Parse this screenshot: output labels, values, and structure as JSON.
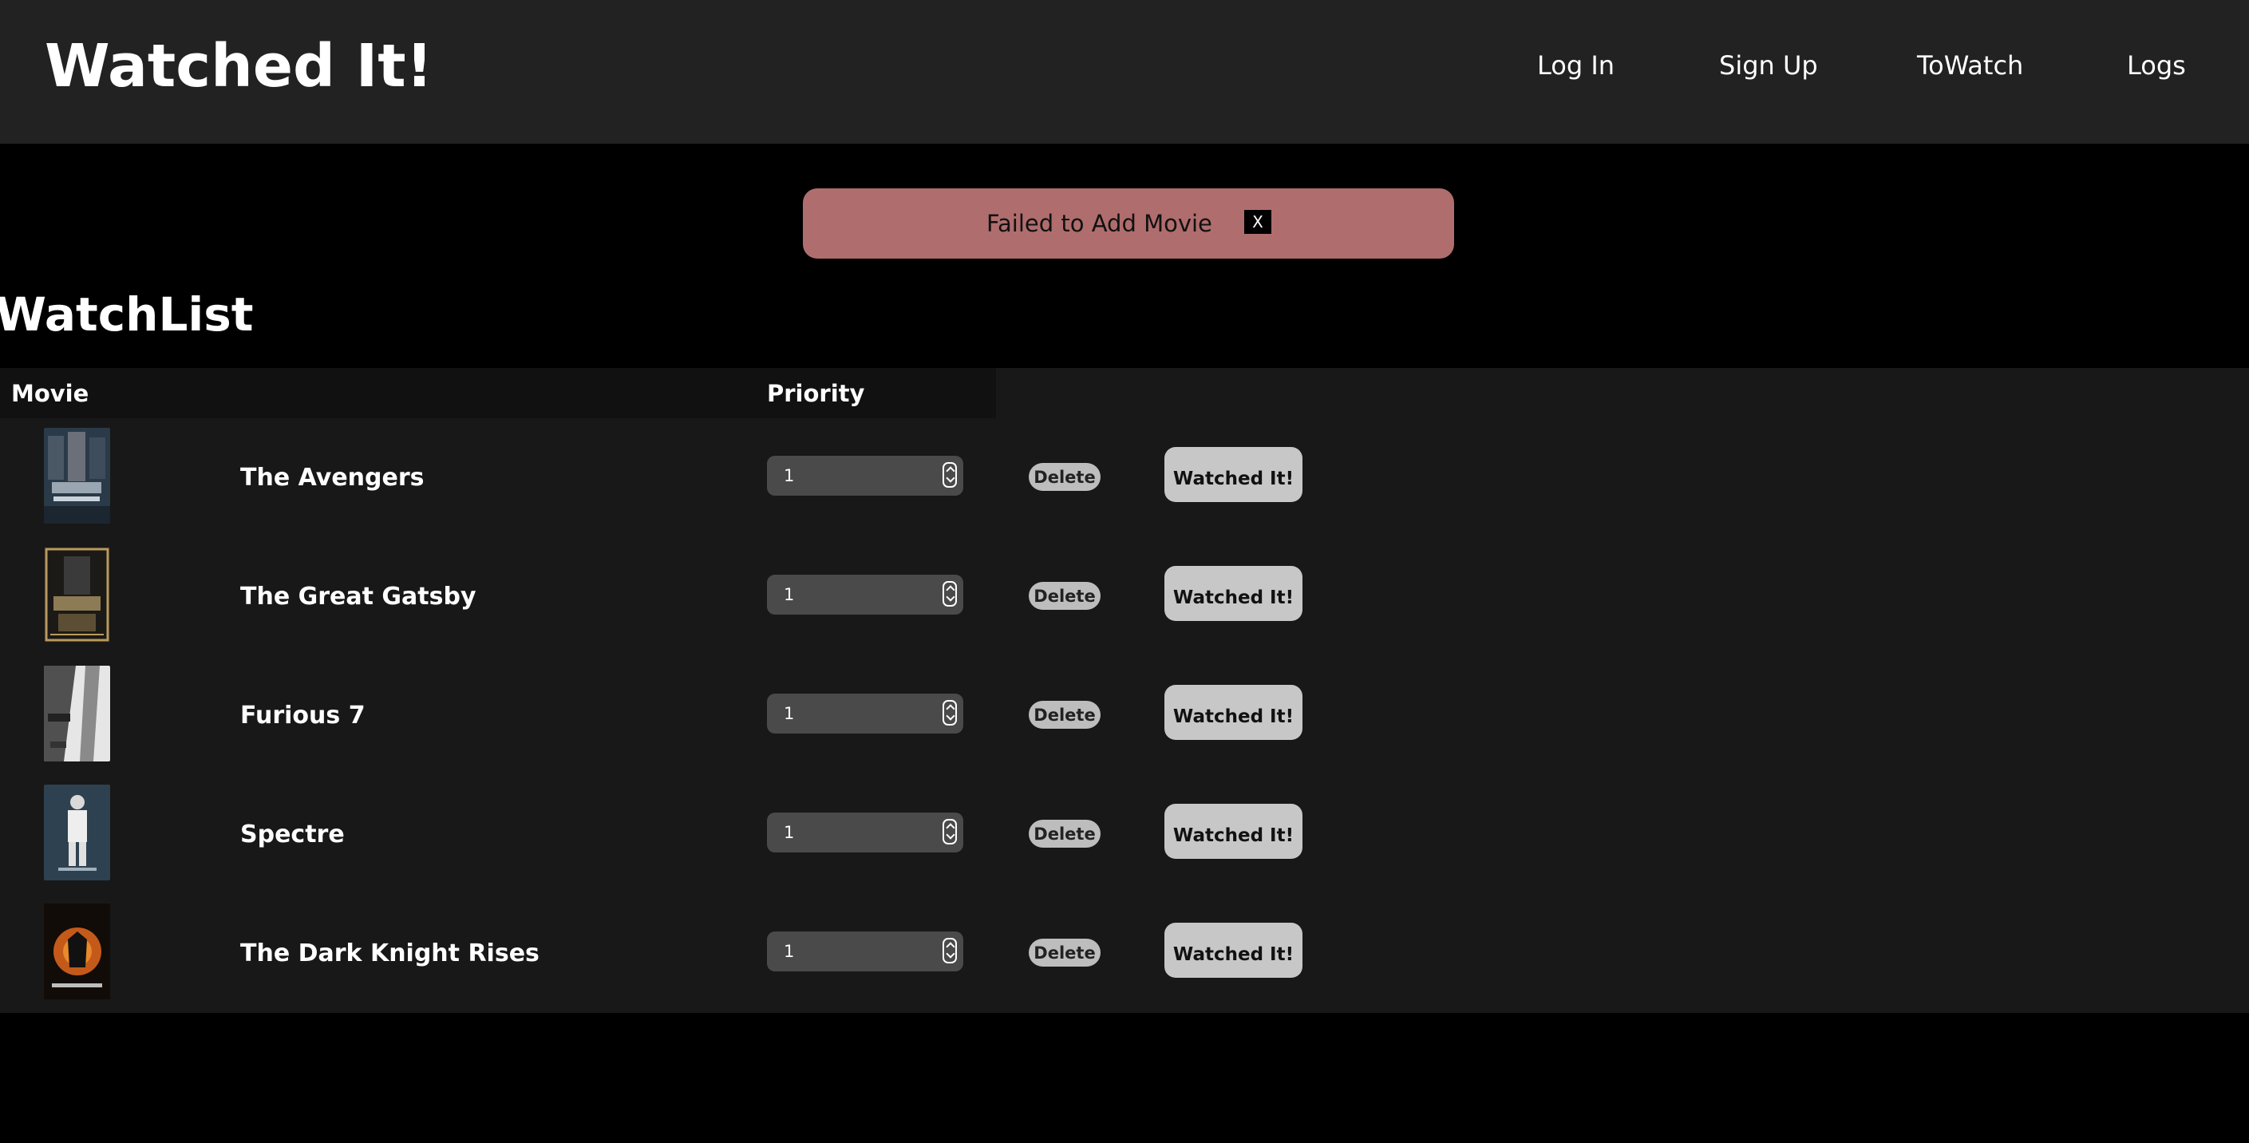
{
  "header": {
    "title": "Watched It!",
    "nav": [
      {
        "label": "Log In"
      },
      {
        "label": "Sign Up"
      },
      {
        "label": "ToWatch"
      },
      {
        "label": "Logs"
      }
    ]
  },
  "alert": {
    "message": "Failed to Add Movie",
    "close_label": "X"
  },
  "page_heading": "WatchList",
  "table": {
    "headers": {
      "movie": "Movie",
      "priority": "Priority"
    },
    "rows": [
      {
        "title": "The Avengers",
        "priority": "1",
        "delete_label": "Delete",
        "watched_label": "Watched It!"
      },
      {
        "title": "The Great Gatsby",
        "priority": "1",
        "delete_label": "Delete",
        "watched_label": "Watched It!"
      },
      {
        "title": "Furious 7",
        "priority": "1",
        "delete_label": "Delete",
        "watched_label": "Watched It!"
      },
      {
        "title": "Spectre",
        "priority": "1",
        "delete_label": "Delete",
        "watched_label": "Watched It!"
      },
      {
        "title": "The Dark Knight Rises",
        "priority": "1",
        "delete_label": "Delete",
        "watched_label": "Watched It!"
      }
    ]
  },
  "colors": {
    "header_bg": "#222222",
    "page_bg": "#000000",
    "table_bg": "#181818",
    "alert_bg": "#b06d6d",
    "button_bg": "#c7c7c7"
  }
}
